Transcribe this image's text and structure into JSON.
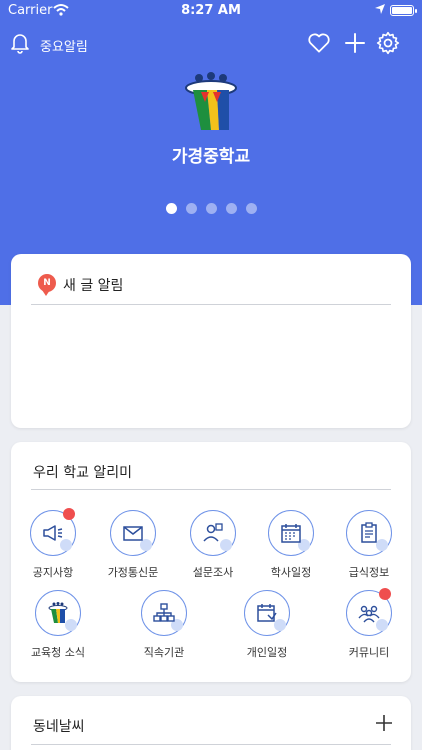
{
  "status_bar": {
    "carrier": "Carrier",
    "time": "8:27 AM"
  },
  "header": {
    "alert_label": "중요알림",
    "school_name": "가경중학교",
    "slides_count": 5,
    "active_slide": 1
  },
  "news_card": {
    "title": "새 글 알림",
    "badge": "N"
  },
  "school_card": {
    "title": "우리 학교 알리미",
    "items": [
      {
        "label": "공지사항",
        "icon": "megaphone-icon",
        "has_alert": true
      },
      {
        "label": "가정통신문",
        "icon": "mail-icon",
        "has_alert": false
      },
      {
        "label": "설문조사",
        "icon": "survey-icon",
        "has_alert": false
      },
      {
        "label": "학사일정",
        "icon": "calendar-icon",
        "has_alert": false
      },
      {
        "label": "급식정보",
        "icon": "clipboard-icon",
        "has_alert": false
      },
      {
        "label": "교육청 소식",
        "icon": "education-office-logo-icon",
        "has_alert": false
      },
      {
        "label": "직속기관",
        "icon": "org-chart-icon",
        "has_alert": false
      },
      {
        "label": "개인일정",
        "icon": "personal-schedule-icon",
        "has_alert": false
      },
      {
        "label": "커뮤니티",
        "icon": "community-icon",
        "has_alert": true
      }
    ]
  },
  "weather_card": {
    "title": "동네날씨"
  },
  "colors": {
    "brand_blue": "#4f6fe7",
    "icon_border": "#6f93e8",
    "alert_red": "#ef4e4e"
  }
}
